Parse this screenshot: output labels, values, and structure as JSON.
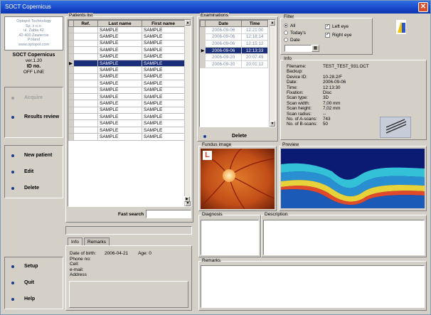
{
  "window": {
    "title": "SOCT Copernicus",
    "close_label": "✕"
  },
  "company": {
    "lines": [
      "Optopol Technology",
      "Sp. z o.o.",
      "ul. Żabia 42",
      "42-400 Zawiercie",
      "Poland",
      "www.optopol.com"
    ]
  },
  "app": {
    "name": "SOCT Copernicus",
    "version": "ver.1.20",
    "id_label": "ID no.",
    "status": "OFF LINE"
  },
  "sidebar": {
    "buttons_top": [
      {
        "label": "Acquire",
        "disabled": true
      },
      {
        "label": "Results review",
        "disabled": false
      }
    ],
    "buttons_mid": [
      {
        "label": "New patient"
      },
      {
        "label": "Edit"
      },
      {
        "label": "Delete"
      }
    ],
    "buttons_bottom": [
      {
        "label": "Setup"
      },
      {
        "label": "Quit"
      },
      {
        "label": "Help"
      }
    ]
  },
  "patients": {
    "group_label": "Patients list",
    "headers": [
      "Ref.",
      "Last name",
      "First name"
    ],
    "rows": [
      [
        "",
        "SAMPLE",
        "SAMPLE"
      ],
      [
        "",
        "SAMPLE",
        "SAMPLE"
      ],
      [
        "",
        "SAMPLE",
        "SAMPLE"
      ],
      [
        "",
        "SAMPLE",
        "SAMPLE"
      ],
      [
        "",
        "SAMPLE",
        "SAMPLE"
      ],
      [
        "",
        "SAMPLE",
        "SAMPLE"
      ],
      [
        "",
        "SAMPLE",
        "SAMPLE"
      ],
      [
        "",
        "SAMPLE",
        "SAMPLE"
      ],
      [
        "",
        "SAMPLE",
        "SAMPLE"
      ],
      [
        "",
        "SAMPLE",
        "SAMPLE"
      ],
      [
        "",
        "SAMPLE",
        "SAMPLE"
      ],
      [
        "",
        "SAMPLE",
        "SAMPLE"
      ],
      [
        "",
        "SAMPLE",
        "SAMPLE"
      ],
      [
        "",
        "SAMPLE",
        "SAMPLE"
      ],
      [
        "",
        "SAMPLE",
        "SAMPLE"
      ],
      [
        "",
        "SAMPLE",
        "SAMPLE"
      ],
      [
        "",
        "SAMPLE",
        "SAMPLE"
      ]
    ],
    "active_row": 5,
    "fast_search_label": "Fast search"
  },
  "patient_details": {
    "tabs": [
      "Info",
      "Remarks"
    ],
    "dob_label": "Date of birth:",
    "dob_value": "2006-04-21",
    "age_label": "Age: 0",
    "phone_label": "Phone no:",
    "cell_label": "Cell:",
    "email_label": "e-mail:",
    "address_label": "Address"
  },
  "examinations": {
    "group_label": "Examinations",
    "headers": [
      "Date",
      "Time"
    ],
    "rows": [
      [
        "2006-09-06",
        "12:21:00"
      ],
      [
        "2006-09-06",
        "12:18:14"
      ],
      [
        "2006-09-06",
        "12:15:12"
      ],
      [
        "2006-09-06",
        "12:13:33"
      ],
      [
        "2006-09-20",
        "20:07:49"
      ],
      [
        "2006-09-20",
        "20:01:12"
      ]
    ],
    "active_row": 3,
    "delete_label": "Delete"
  },
  "filter": {
    "group_label": "Filter",
    "options": [
      "All",
      "Today's",
      "Date"
    ],
    "selected": "All",
    "left_eye": "Left eye",
    "right_eye": "Right eye"
  },
  "info": {
    "group_label": "Info",
    "fields": [
      [
        "Filename:",
        "TEST_TEST_931.OCT"
      ],
      [
        "Backup:",
        ""
      ],
      [
        "Device ID:",
        "10-28.2/F"
      ],
      [
        "Date:",
        "2006-09-06"
      ],
      [
        "Time:",
        "12:13:30"
      ],
      [
        "Fixation:",
        "Disc"
      ],
      [
        "Scan type:",
        "3D"
      ],
      [
        "Scan width:",
        "7,00 mm"
      ],
      [
        "Scan height:",
        "7,02 mm"
      ],
      [
        "Scan radius:",
        "--"
      ],
      [
        "No. of A-scans:",
        "743"
      ],
      [
        "No. of B-scans:",
        "50"
      ]
    ]
  },
  "images": {
    "fundus_label": "Fundus image",
    "eye_badge": "L",
    "preview_label": "Preview"
  },
  "notes": {
    "diagnosis_label": "Diagnosis",
    "description_label": "Description",
    "remarks_label": "Remarks"
  },
  "colors": {
    "titlebar": "#1747c8",
    "selection": "#1a2e7a",
    "button_dot": "#1a3a8a",
    "eye_badge": "#e0452a"
  }
}
